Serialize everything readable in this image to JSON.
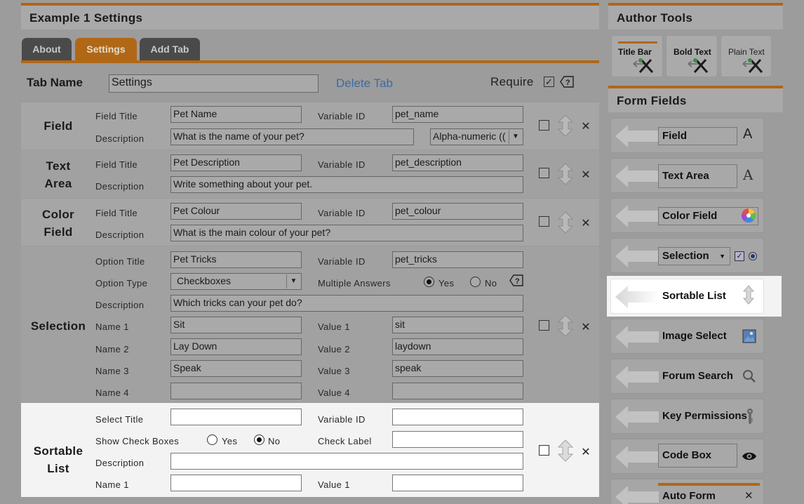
{
  "main": {
    "title": "Example 1 Settings",
    "tabs": [
      {
        "label": "About"
      },
      {
        "label": "Settings"
      },
      {
        "label": "Add Tab"
      }
    ],
    "tab_name_label": "Tab Name",
    "tab_name_value": "Settings",
    "delete_tab": "Delete Tab",
    "require_label": "Require"
  },
  "rows": {
    "field": {
      "section": "Field",
      "title_label": "Field Title",
      "title_value": "Pet Name",
      "var_label": "Variable ID",
      "var_value": "pet_name",
      "desc_label": "Description",
      "desc_value": "What is the name of your pet?",
      "format_value": "Alpha-numeric (("
    },
    "textarea": {
      "section_line1": "Text",
      "section_line2": "Area",
      "title_label": "Field Title",
      "title_value": "Pet Description",
      "var_label": "Variable ID",
      "var_value": "pet_description",
      "desc_label": "Description",
      "desc_value": "Write something about your pet."
    },
    "color": {
      "section_line1": "Color",
      "section_line2": "Field",
      "title_label": "Field Title",
      "title_value": "Pet Colour",
      "var_label": "Variable ID",
      "var_value": "pet_colour",
      "desc_label": "Description",
      "desc_value": "What is the main colour of your pet?"
    },
    "selection": {
      "section": "Selection",
      "option_title_label": "Option Title",
      "option_title_value": "Pet Tricks",
      "var_label": "Variable ID",
      "var_value": "pet_tricks",
      "option_type_label": "Option Type",
      "option_type_value": "Checkboxes",
      "multiple_label": "Multiple Answers",
      "yes": "Yes",
      "no": "No",
      "desc_label": "Description",
      "desc_value": "Which tricks can your pet do?",
      "names": [
        {
          "name_label": "Name 1",
          "name_value": "Sit",
          "value_label": "Value 1",
          "value_value": "sit"
        },
        {
          "name_label": "Name 2",
          "name_value": "Lay Down",
          "value_label": "Value 2",
          "value_value": "laydown"
        },
        {
          "name_label": "Name 3",
          "name_value": "Speak",
          "value_label": "Value 3",
          "value_value": "speak"
        },
        {
          "name_label": "Name 4",
          "name_value": "",
          "value_label": "Value 4",
          "value_value": ""
        }
      ]
    },
    "sortable": {
      "section_line1": "Sortable",
      "section_line2": "List",
      "select_title_label": "Select Title",
      "var_label": "Variable ID",
      "show_cb_label": "Show Check Boxes",
      "yes": "Yes",
      "no": "No",
      "check_label": "Check Label",
      "desc_label": "Description",
      "name1_label": "Name 1",
      "value1_label": "Value 1"
    }
  },
  "sidebar": {
    "author_tools_title": "Author Tools",
    "tools": [
      {
        "label": "Title Bar"
      },
      {
        "label": "Bold Text"
      },
      {
        "label": "Plain Text"
      }
    ],
    "form_fields_title": "Form Fields",
    "fields": [
      {
        "label": "Field"
      },
      {
        "label": "Text Area"
      },
      {
        "label": "Color Field"
      },
      {
        "label": "Selection"
      },
      {
        "label": "Sortable List"
      },
      {
        "label": "Image Select"
      },
      {
        "label": "Forum Search"
      },
      {
        "label": "Key Permissions"
      },
      {
        "label": "Code Box"
      },
      {
        "label": "Auto Form"
      }
    ]
  },
  "icons": {
    "drag_handle": "arrows-up-down-icon",
    "remove": "close-icon",
    "help": "help-tag-icon",
    "tools": "wrench-screwdriver-icon",
    "left_arrow": "drag-left-arrow-icon"
  },
  "colors": {
    "accent": "#b06817",
    "highlight": "#f3f3f3",
    "link": "#3d6aa8"
  }
}
